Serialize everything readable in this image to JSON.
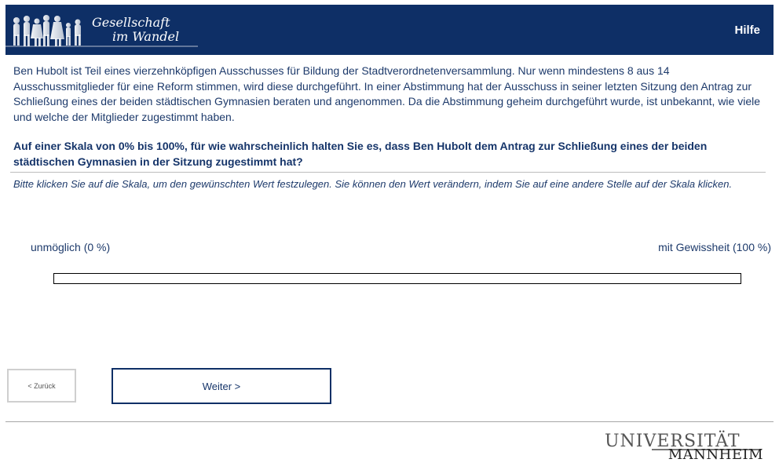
{
  "header": {
    "logo_line1": "Gesellschaft",
    "logo_line2": "im Wandel",
    "help_label": "Hilfe",
    "background_color": "#0e2f66"
  },
  "intro_text": "Ben Hubolt ist Teil eines vierzehnköpfigen Ausschusses für Bildung der Stadtverordnetenversammlung. Nur wenn mindestens 8 aus 14 Ausschussmitglieder für eine Reform stimmen, wird diese durchgeführt. In einer Abstimmung hat der Ausschuss in seiner letzten Sitzung den Antrag zur Schließung eines der beiden städtischen Gymnasien beraten und angenommen. Da die Abstimmung geheim durchgeführt wurde, ist unbekannt, wie viele und welche der Mitglieder zugestimmt haben.",
  "question_text": "Auf einer Skala von 0% bis 100%, für wie wahrscheinlich halten Sie es, dass Ben Hubolt dem Antrag zur Schließung eines der beiden städtischen Gymnasien in der Sitzung zugestimmt hat?",
  "instruction_text": "Bitte klicken Sie auf die Skala, um den gewünschten Wert festzulegen. Sie können den Wert verändern, indem Sie auf eine andere Stelle auf der Skala klicken.",
  "scale": {
    "min_label": "unmöglich (0 %)",
    "max_label": "mit Gewissheit (100 %)"
  },
  "navigation": {
    "back_label": "< Zurück",
    "next_label": "Weiter >"
  },
  "footer": {
    "logo_line1": "UNIVERSITÄT",
    "logo_line2": "MANNHEIM"
  }
}
